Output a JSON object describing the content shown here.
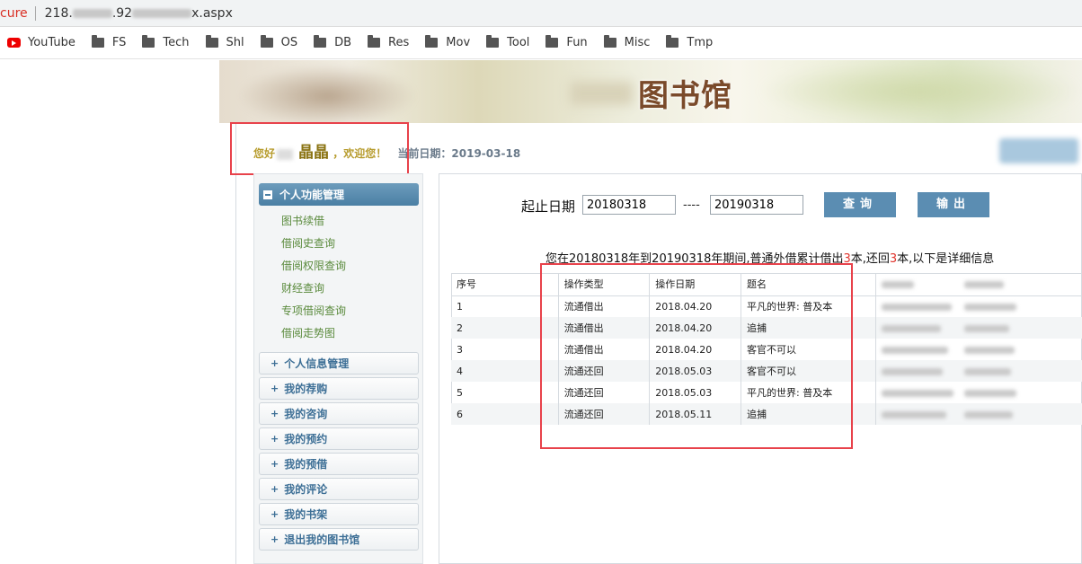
{
  "browser": {
    "security_text": "cure",
    "url_start": "218.",
    "url_mid": ".92",
    "url_end": "x.aspx",
    "bookmarks": [
      {
        "label": "YouTube",
        "icon": "youtube-icon"
      },
      {
        "label": "FS",
        "icon": "folder-icon"
      },
      {
        "label": "Tech",
        "icon": "folder-icon"
      },
      {
        "label": "Shl",
        "icon": "folder-icon"
      },
      {
        "label": "OS",
        "icon": "folder-icon"
      },
      {
        "label": "DB",
        "icon": "folder-icon"
      },
      {
        "label": "Res",
        "icon": "folder-icon"
      },
      {
        "label": "Mov",
        "icon": "folder-icon"
      },
      {
        "label": "Tool",
        "icon": "folder-icon"
      },
      {
        "label": "Fun",
        "icon": "folder-icon"
      },
      {
        "label": "Misc",
        "icon": "folder-icon"
      },
      {
        "label": "Tmp",
        "icon": "folder-icon"
      }
    ]
  },
  "banner": {
    "logo": "图书馆"
  },
  "header": {
    "greeting": "您好",
    "name": "晶晶",
    "welcome": "，欢迎您！",
    "date_label": "当前日期：2019-03-18"
  },
  "sidebar": {
    "main_section": "个人功能管理",
    "items": [
      "图书续借",
      "借阅史查询",
      "借阅权限查询",
      "财经查询",
      "专项借阅查询",
      "借阅走势图"
    ],
    "sections": [
      "个人信息管理",
      "我的荐购",
      "我的咨询",
      "我的预约",
      "我的预借",
      "我的评论",
      "我的书架",
      "退出我的图书馆"
    ]
  },
  "search": {
    "label": "起止日期",
    "start": "20180318",
    "separator": "----",
    "end": "20190318",
    "query_button": "查询",
    "export_button": "输出"
  },
  "summary": {
    "prefix": "您在20180318年到20190318年期间,普通外借累计借出",
    "borrowed": "3",
    "middle": "本,还回",
    "returned": "3",
    "suffix": "本,以下是详细信息"
  },
  "table": {
    "headers": [
      "序号",
      "操作类型",
      "操作日期",
      "题名"
    ],
    "rows": [
      [
        "1",
        "流通借出",
        "2018.04.20",
        "平凡的世界: 普及本"
      ],
      [
        "2",
        "流通借出",
        "2018.04.20",
        "追捕"
      ],
      [
        "3",
        "流通借出",
        "2018.04.20",
        "客官不可以"
      ],
      [
        "4",
        "流通还回",
        "2018.05.03",
        "客官不可以"
      ],
      [
        "5",
        "流通还回",
        "2018.05.03",
        "平凡的世界: 普及本"
      ],
      [
        "6",
        "流通还回",
        "2018.05.11",
        "追捕"
      ]
    ]
  },
  "colors": {
    "accent": "#5b8db2",
    "highlight_box": "#e8424b",
    "sidebar_text": "#5a8a3c"
  }
}
